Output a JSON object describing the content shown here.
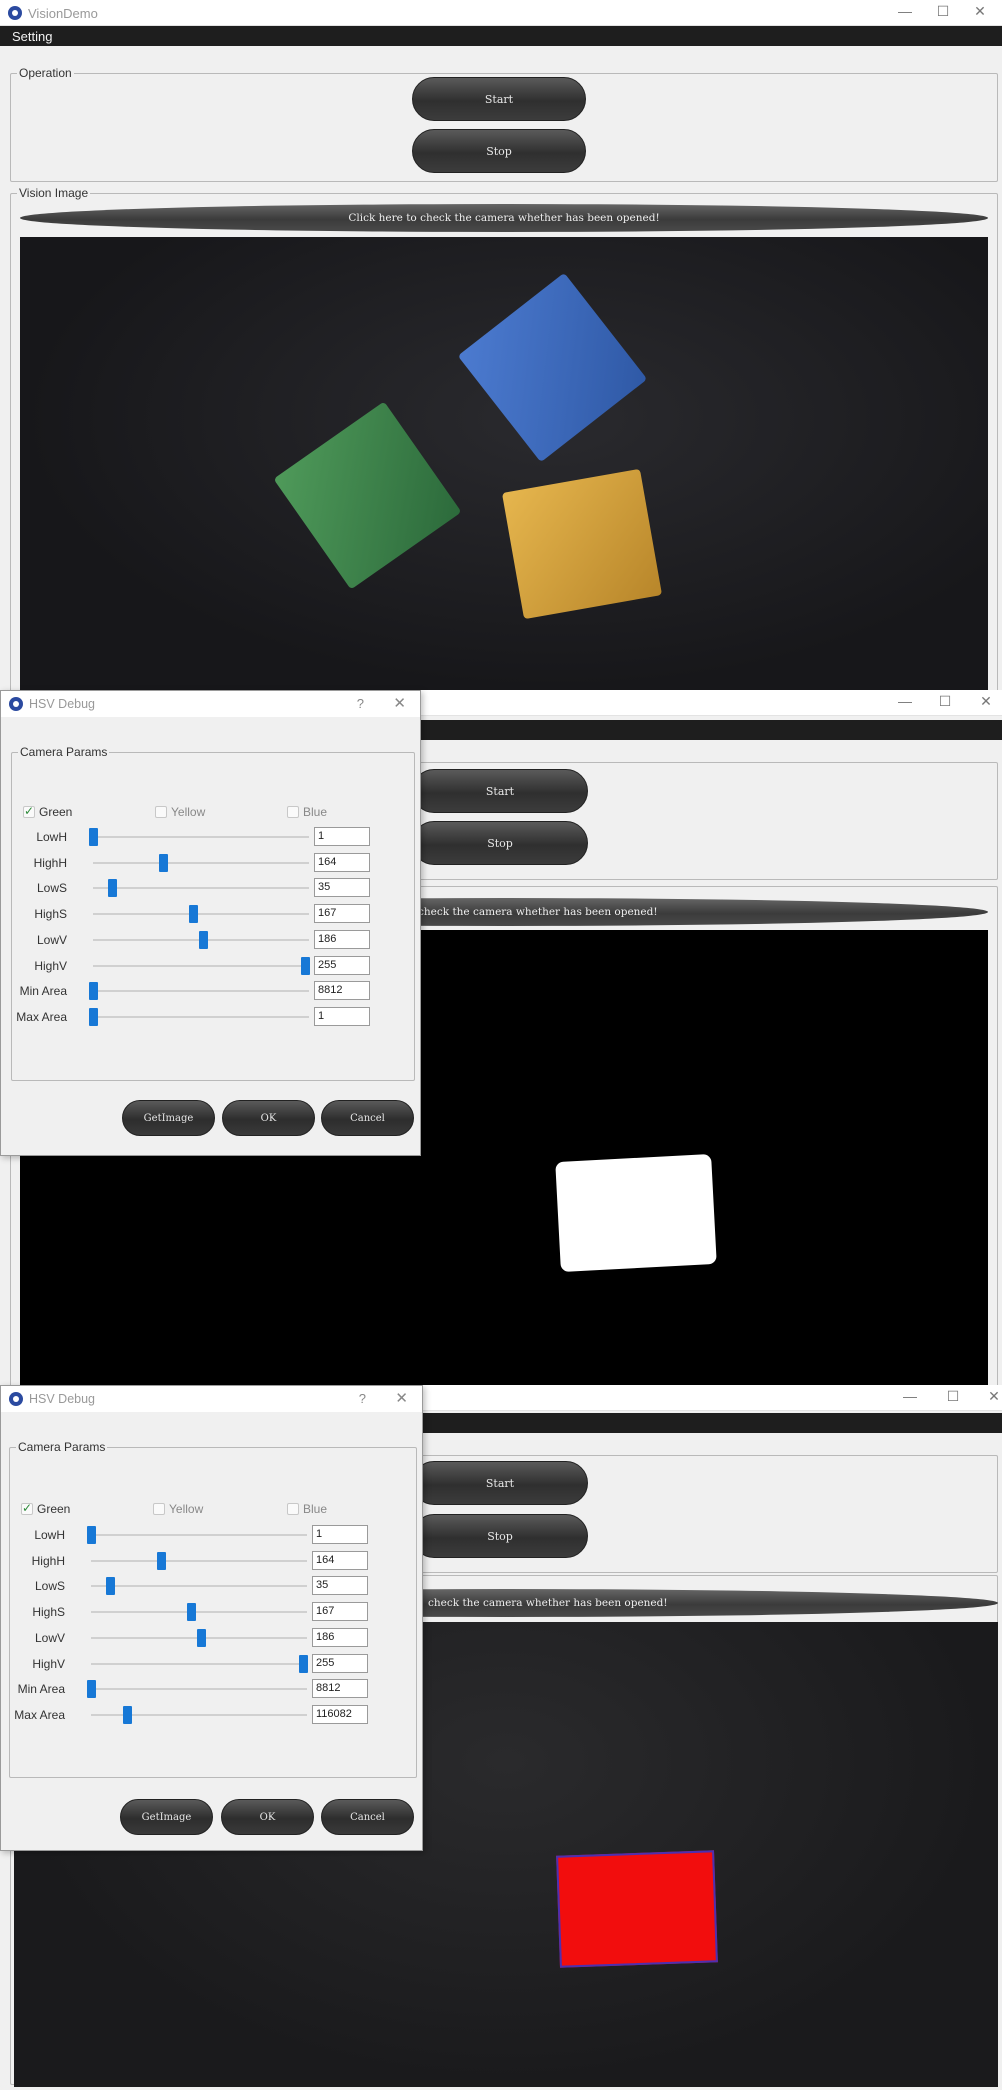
{
  "main_window": {
    "title": "VisionDemo",
    "menu": "Setting",
    "operation_group": "Operation",
    "start_label": "Start",
    "stop_label": "Stop",
    "vision_group": "Vision Image",
    "camera_status": "Click here to check the camera whether has been opened!",
    "camera_status_partial": "check the camera whether has been opened!",
    "controls": {
      "minimize": "—",
      "maximize": "☐",
      "close": "✕"
    }
  },
  "hsv_dialog_1": {
    "title": "HSV Debug",
    "help": "?",
    "close": "✕",
    "group": "Camera Params",
    "colors": [
      {
        "label": "Green",
        "checked": true
      },
      {
        "label": "Yellow",
        "checked": false
      },
      {
        "label": "Blue",
        "checked": false
      }
    ],
    "params": [
      {
        "label": "LowH",
        "value": "1",
        "level": 0.0
      },
      {
        "label": "HighH",
        "value": "164",
        "level": 0.33
      },
      {
        "label": "LowS",
        "value": "35",
        "level": 0.09
      },
      {
        "label": "HighS",
        "value": "167",
        "level": 0.47
      },
      {
        "label": "LowV",
        "value": "186",
        "level": 0.52
      },
      {
        "label": "HighV",
        "value": "255",
        "level": 1.0
      },
      {
        "label": "Min Area",
        "value": "8812",
        "level": 0.0
      },
      {
        "label": "Max Area",
        "value": "1",
        "level": 0.0
      }
    ],
    "buttons": {
      "get_image": "GetImage",
      "ok": "OK",
      "cancel": "Cancel"
    }
  },
  "hsv_dialog_2": {
    "title": "HSV Debug",
    "help": "?",
    "close": "✕",
    "group": "Camera Params",
    "colors": [
      {
        "label": "Green",
        "checked": true
      },
      {
        "label": "Yellow",
        "checked": false
      },
      {
        "label": "Blue",
        "checked": false
      }
    ],
    "params": [
      {
        "label": "LowH",
        "value": "1",
        "level": 0.0
      },
      {
        "label": "HighH",
        "value": "164",
        "level": 0.33
      },
      {
        "label": "LowS",
        "value": "35",
        "level": 0.09
      },
      {
        "label": "HighS",
        "value": "167",
        "level": 0.47
      },
      {
        "label": "LowV",
        "value": "186",
        "level": 0.52
      },
      {
        "label": "HighV",
        "value": "255",
        "level": 1.0
      },
      {
        "label": "Min Area",
        "value": "8812",
        "level": 0.0
      },
      {
        "label": "Max Area",
        "value": "116082",
        "level": 0.17
      }
    ],
    "buttons": {
      "get_image": "GetImage",
      "ok": "OK",
      "cancel": "Cancel"
    }
  }
}
